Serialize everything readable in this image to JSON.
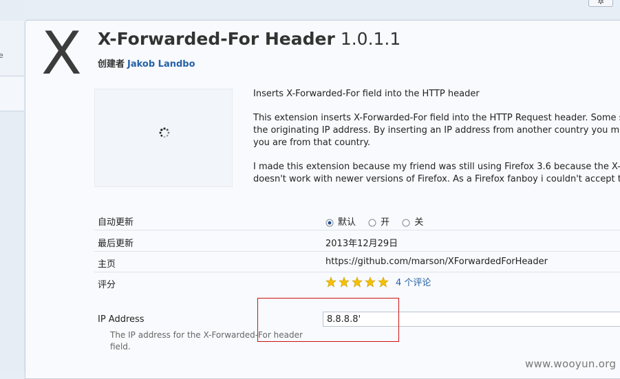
{
  "addon": {
    "logo_letter": "X",
    "name": "X-Forwarded-For Header",
    "version": "1.0.1.1",
    "creator_label": "创建者",
    "creator_name": "Jakob Landbo"
  },
  "description": {
    "summary": "Inserts X-Forwarded-For field into the HTTP header",
    "para1_line1": "This extension inserts X-Forwarded-For field into the HTTP Request header. Some se",
    "para1_line2": "the originating IP address. By inserting an IP address from another country you may",
    "para1_line3": "you are from that country.",
    "para2_line1": "I made this extension because my friend was still using Firefox 3.6 because the X-For",
    "para2_line2": "doesn't work with newer versions of Firefox. As a Firefox fanboy i couldn't accept tha"
  },
  "details": {
    "auto_update_label": "自动更新",
    "auto_update_options": [
      "默认",
      "开",
      "关"
    ],
    "auto_update_selected": "默认",
    "last_updated_label": "最后更新",
    "last_updated_value": "2013年12月29日",
    "homepage_label": "主页",
    "homepage_url": "https://github.com/marson/XForwardedForHeader",
    "rating_label": "评分",
    "rating_stars": 5,
    "reviews_text": "4 个评论"
  },
  "preferences": {
    "ip_label": "IP Address",
    "ip_value": "8.8.8.8'",
    "ip_help": "The IP address for the X-Forwarded-For header field."
  },
  "watermark": "www.wooyun.org",
  "colors": {
    "link": "#2561a6",
    "highlight_box": "#d01010",
    "star": "#f5c000"
  }
}
